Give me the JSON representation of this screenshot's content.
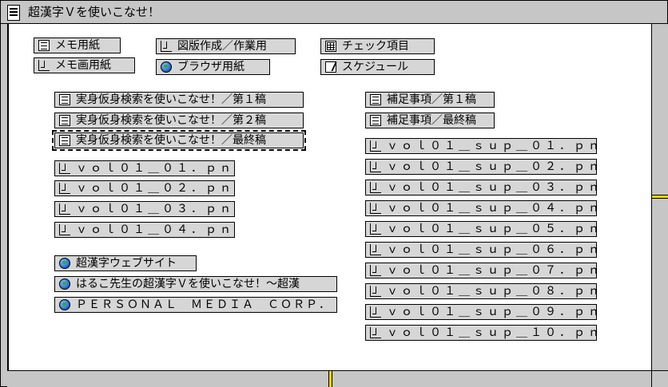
{
  "window": {
    "title": "超漢字Ｖを使いこなせ！"
  },
  "top_items": [
    {
      "label": "メモ用紙",
      "icon": "document-icon"
    },
    {
      "label": "メモ画用紙",
      "icon": "figure-icon"
    },
    {
      "label": "図版作成／作業用",
      "icon": "figure-icon"
    },
    {
      "label": "ブラウザ用紙",
      "icon": "globe-icon"
    },
    {
      "label": "チェック項目",
      "icon": "table-icon"
    },
    {
      "label": "スケジュール",
      "icon": "schedule-icon"
    }
  ],
  "left_docs": [
    {
      "label": "実身仮身検索を使いこなせ！／第１稿",
      "icon": "document-icon"
    },
    {
      "label": "実身仮身検索を使いこなせ！／第２稿",
      "icon": "document-icon"
    },
    {
      "label": "実身仮身検索を使いこなせ！／最終稿",
      "icon": "document-icon"
    }
  ],
  "left_images": [
    {
      "label": "ｖｏｌ０１＿０１．ｐｎｇ",
      "icon": "figure-icon"
    },
    {
      "label": "ｖｏｌ０１＿０２．ｐｎｇ",
      "icon": "figure-icon"
    },
    {
      "label": "ｖｏｌ０１＿０３．ｐｎｇ",
      "icon": "figure-icon"
    },
    {
      "label": "ｖｏｌ０１＿０４．ｐｎｇ",
      "icon": "figure-icon"
    }
  ],
  "left_links": [
    {
      "label": "超漢字ウェブサイト",
      "icon": "globe-icon"
    },
    {
      "label": "はるこ先生の超漢字Ｖを使いこなせ！～超漢",
      "icon": "globe-icon"
    },
    {
      "label": "ＰＥＲＳＯＮＡＬ　ＭＥＤＩＡ　ＣＯＲＰ．",
      "icon": "globe-icon"
    }
  ],
  "right_docs": [
    {
      "label": "補足事項／第１稿",
      "icon": "document-icon"
    },
    {
      "label": "補足事項／最終稿",
      "icon": "document-icon"
    }
  ],
  "right_images": [
    {
      "label": "ｖｏｌ０１＿ｓｕｐ＿０１．ｐｎｇ",
      "icon": "figure-icon"
    },
    {
      "label": "ｖｏｌ０１＿ｓｕｐ＿０２．ｐｎｇ",
      "icon": "figure-icon"
    },
    {
      "label": "ｖｏｌ０１＿ｓｕｐ＿０３．ｐｎｇ",
      "icon": "figure-icon"
    },
    {
      "label": "ｖｏｌ０１＿ｓｕｐ＿０４．ｐｎｇ",
      "icon": "figure-icon"
    },
    {
      "label": "ｖｏｌ０１＿ｓｕｐ＿０５．ｐｎｇ",
      "icon": "figure-icon"
    },
    {
      "label": "ｖｏｌ０１＿ｓｕｐ＿０６．ｐｎｇ",
      "icon": "figure-icon"
    },
    {
      "label": "ｖｏｌ０１＿ｓｕｐ＿０７．ｐｎｇ",
      "icon": "figure-icon"
    },
    {
      "label": "ｖｏｌ０１＿ｓｕｐ＿０８．ｐｎｇ",
      "icon": "figure-icon"
    },
    {
      "label": "ｖｏｌ０１＿ｓｕｐ＿０９．ｐｎｇ",
      "icon": "figure-icon"
    },
    {
      "label": "ｖｏｌ０１＿ｓｕｐ＿１０．ｐｎｇ",
      "icon": "figure-icon"
    }
  ],
  "colors": {
    "window_bg": "#c6c6c6",
    "content_bg": "#ffffff",
    "scroll_thumb": "#ffd800",
    "item_bg": "#d6d6d6"
  }
}
